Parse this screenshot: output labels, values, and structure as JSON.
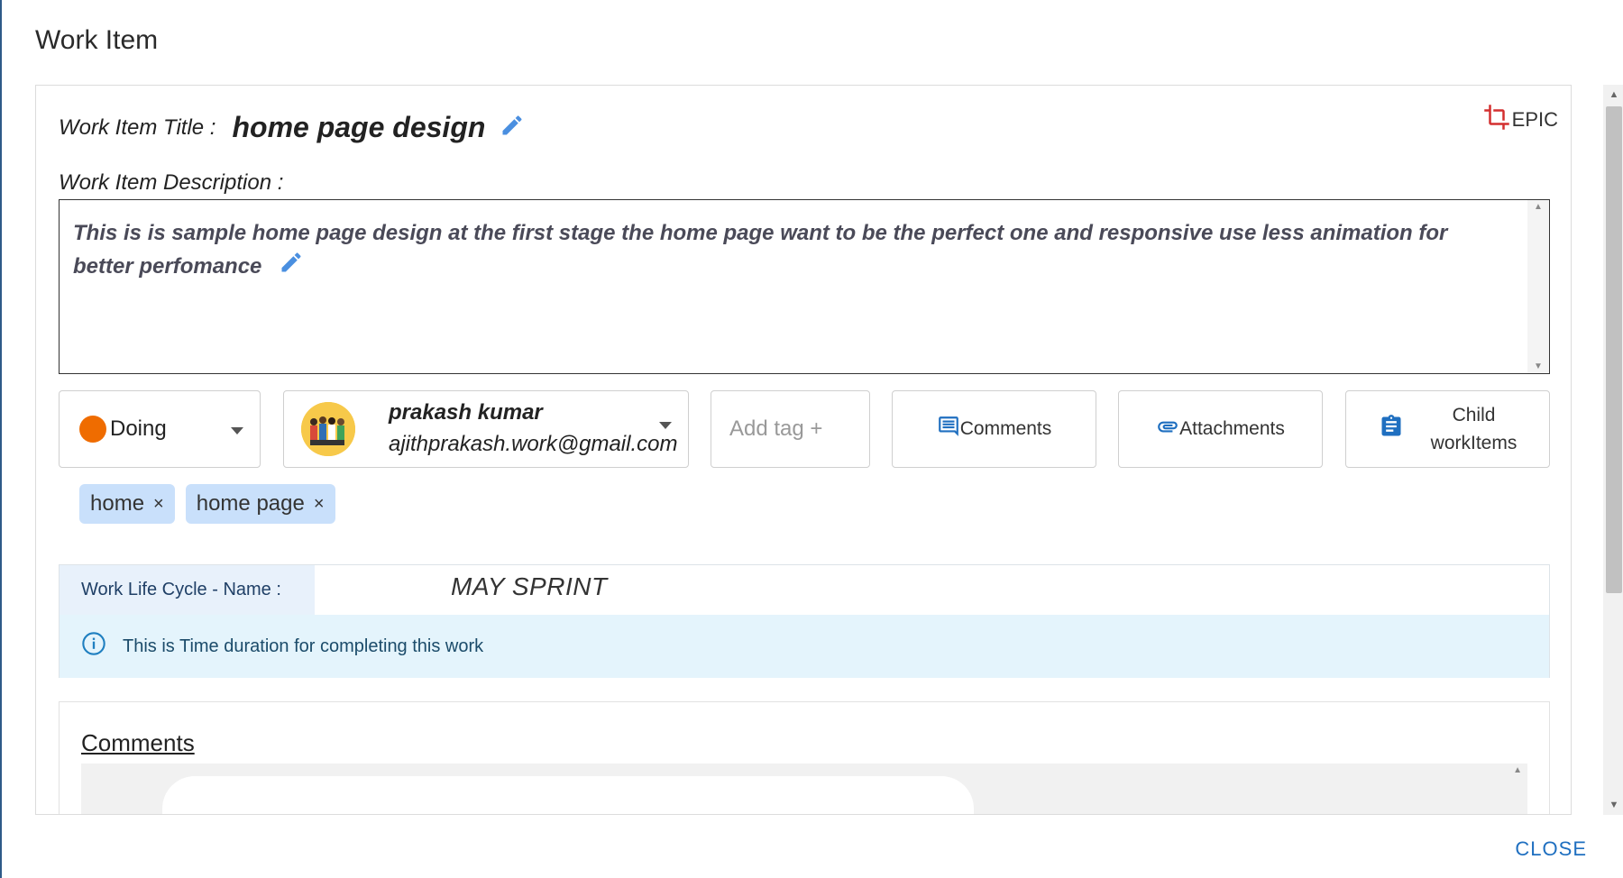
{
  "dialog": {
    "title": "Work Item",
    "close_label": "CLOSE"
  },
  "work_item": {
    "title_label": "Work Item Title :",
    "title": "home page design",
    "type": "EPIC",
    "description_label": "Work Item Description :",
    "description": "This is is sample home page design at the first stage the home page want to be the perfect one and responsive use less animation for better perfomance"
  },
  "status": {
    "value": "Doing",
    "color": "#ef6c00"
  },
  "assignee": {
    "name": "prakash kumar",
    "email": "ajithprakash.work@gmail.com"
  },
  "tag_input": {
    "placeholder": "Add tag +"
  },
  "buttons": {
    "comments": "Comments",
    "attachments": "Attachments",
    "child_line1": "Child",
    "child_line2": "workItems"
  },
  "tags": [
    {
      "label": "home",
      "remove": "×"
    },
    {
      "label": "home page",
      "remove": "×"
    }
  ],
  "work_life_cycle": {
    "label": "Work Life Cycle - Name :",
    "value": "MAY SPRINT",
    "info": "This is Time duration for completing this work"
  },
  "comments_section": {
    "title": "Comments"
  },
  "colors": {
    "accent": "#1f6fc0",
    "chip_bg": "#c9e0fb",
    "info_bg": "#e4f4fc",
    "epic_icon": "#d32f2f",
    "pencil": "#4a8fe0"
  }
}
